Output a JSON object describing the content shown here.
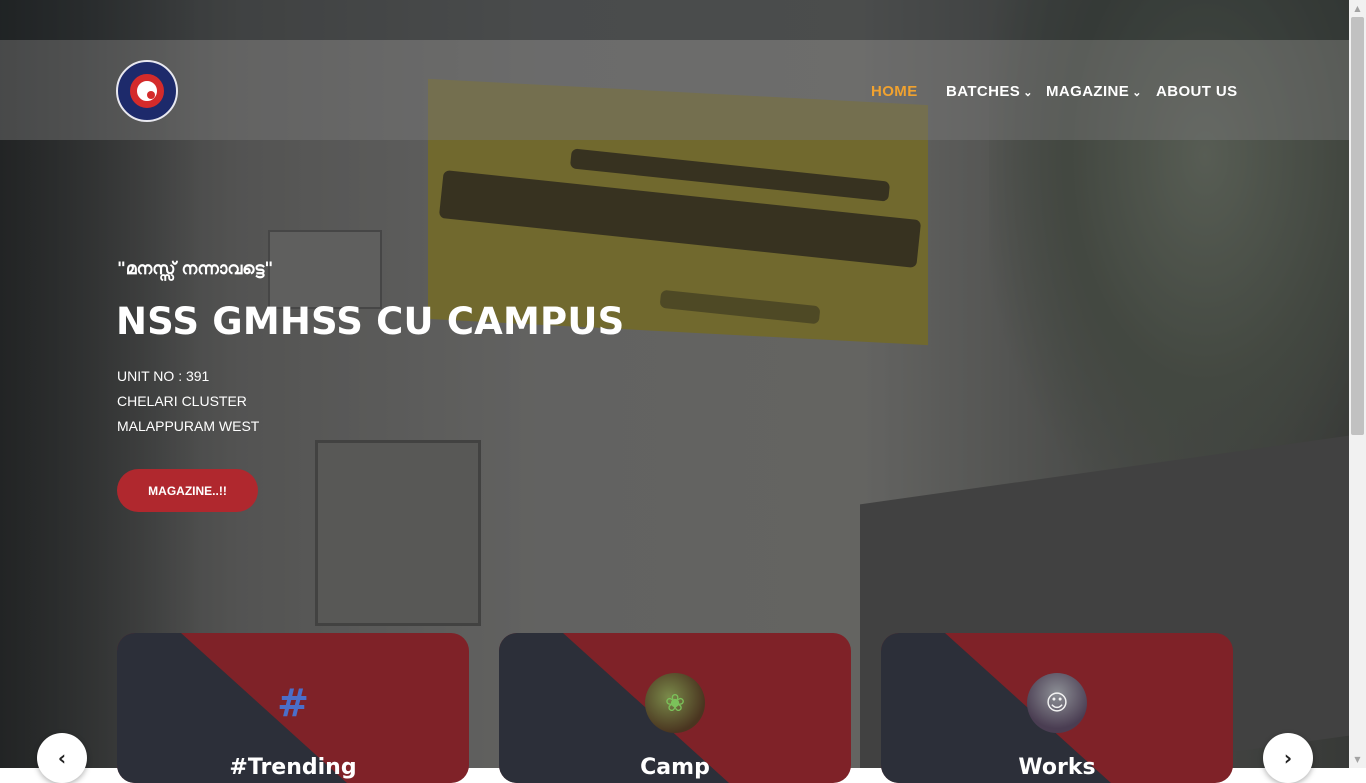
{
  "nav": {
    "home": "HOME",
    "batches": "BATCHES",
    "magazine": "MAGAZINE",
    "about": "ABOUT US",
    "dropdown_icon": "chevron-down-icon",
    "active_color": "#f1a22f"
  },
  "logo": {
    "alt_text": "NATIONAL SERVICE SCHEME",
    "icon": "nss-wheel-logo"
  },
  "hero": {
    "motto": "\"മനസ്സ് നന്നാവട്ടെ\"",
    "title": "NSS GMHSS CU CAMPUS",
    "unit": "UNIT NO : 391",
    "cluster": "CHELARI CLUSTER",
    "district": "MALAPPURAM WEST",
    "button": "MAGAZINE..!!",
    "button_color": "#b0282e"
  },
  "cards": [
    {
      "title": "#Trending",
      "icon": "hashtag-icon"
    },
    {
      "title": "Camp",
      "icon": "camp-photo-icon"
    },
    {
      "title": "Works",
      "icon": "works-photo-icon"
    }
  ],
  "carousel": {
    "prev_icon": "chevron-left-icon",
    "prev_glyph": "‹",
    "next_icon": "chevron-right-icon",
    "next_glyph": "›"
  },
  "colors": {
    "card_red": "#7f2228",
    "card_dark": "#2c2f39"
  }
}
